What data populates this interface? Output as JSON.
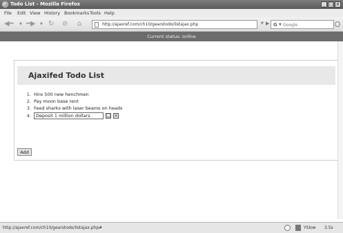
{
  "window": {
    "title": "Todo List - Mozilla Firefox",
    "minimize": "_",
    "maximize": "□",
    "close": "x"
  },
  "menu": {
    "file": "File",
    "edit": "Edit",
    "view": "View",
    "history": "History",
    "bookmarks": "Bookmarks",
    "tools": "Tools",
    "help": "Help"
  },
  "nav": {
    "url": "http://ajaxref.com/ch10/gearstodo/listajax.php",
    "search_placeholder": "Google"
  },
  "banner": {
    "status": "Current status: online"
  },
  "app": {
    "title": "Ajaxifed Todo List",
    "todos": [
      {
        "num": "1.",
        "text": "Hire 500 new henchmen"
      },
      {
        "num": "2.",
        "text": "Pay moon base rent"
      },
      {
        "num": "3.",
        "text": "Feed sharks with laser beams on heads"
      }
    ],
    "edit": {
      "num": "4.",
      "value": "Deposit 1 million dollars"
    },
    "add_label": "Add"
  },
  "statusbar": {
    "url": "http://ajaxref.com/ch10/gearstodo/listajax.php#",
    "yslow": "YSlow",
    "load_time": "3.5s"
  },
  "icons": {
    "save": "save-icon",
    "cancel": "cancel-icon",
    "back": "back-arrow-icon",
    "forward": "forward-arrow-icon",
    "reload": "reload-icon",
    "stop": "stop-icon",
    "home": "home-icon"
  }
}
